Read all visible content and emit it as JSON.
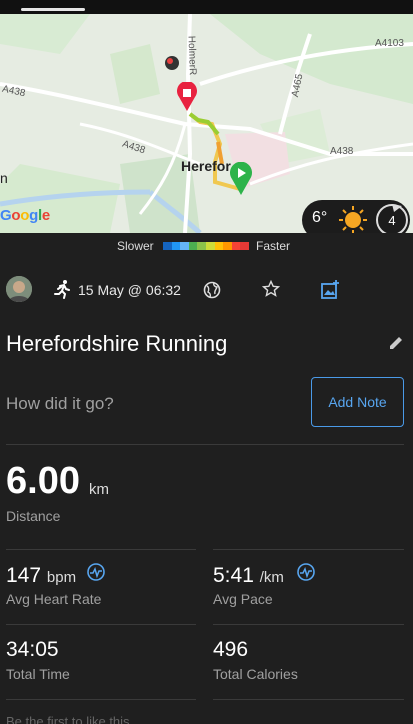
{
  "map": {
    "road_labels": [
      "A438",
      "A438",
      "A438",
      "A465",
      "A4103",
      "HolmerR"
    ],
    "town": "Herefor",
    "edge_label": "n",
    "google_logo": [
      "G",
      "o",
      "o",
      "g",
      "l",
      "e"
    ],
    "route_colors": [
      "#f0c850",
      "#9acd32",
      "#f0a030",
      "#e84040"
    ],
    "start_marker_color": "#2db34a",
    "finish_marker_color": "#e8223f"
  },
  "weather": {
    "temperature": "6°",
    "icon": "sun-icon",
    "wind": "4"
  },
  "legend": {
    "slower": "Slower",
    "faster": "Faster",
    "colors": [
      "#1565c0",
      "#2196f3",
      "#64b5f6",
      "#4caf50",
      "#8bc34a",
      "#cddc39",
      "#ffc107",
      "#ff9800",
      "#f44336",
      "#e53935"
    ]
  },
  "activity": {
    "type_icon": "running-icon",
    "date": "15 May @ 06:32",
    "privacy_icon": "globe-icon",
    "favorite_icon": "star-icon",
    "photo_icon": "add-photo-icon",
    "title": "Herefordshire Running",
    "note_prompt": "How did it go?",
    "add_note_label": "Add Note"
  },
  "stats": {
    "distance": {
      "value": "6.00",
      "unit": "km",
      "label": "Distance"
    },
    "heart_rate": {
      "value": "147",
      "unit": "bpm",
      "label": "Avg Heart Rate"
    },
    "pace": {
      "value": "5:41",
      "unit": "/km",
      "label": "Avg Pace"
    },
    "total_time": {
      "value": "34:05",
      "label": "Total Time"
    },
    "calories": {
      "value": "496",
      "label": "Total Calories"
    }
  },
  "footer": {
    "faded_text": "Be the first to like this"
  },
  "colors": {
    "accent": "#58a6f0",
    "background": "#1f1f1f"
  }
}
